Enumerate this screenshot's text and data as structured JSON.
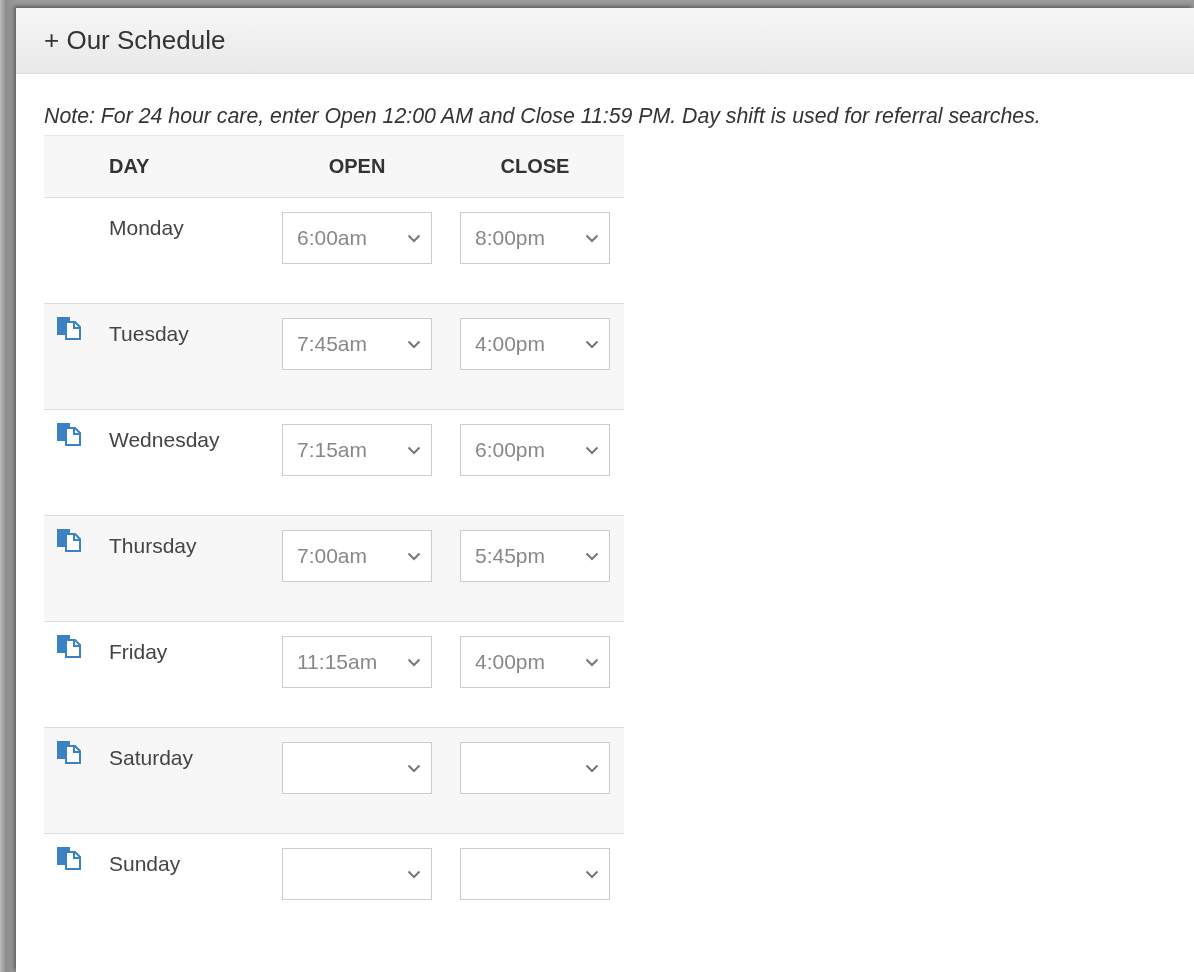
{
  "section": {
    "title": "+ Our Schedule",
    "note": "Note: For 24 hour care, enter Open 12:00 AM and Close 11:59 PM. Day shift is used for referral searches."
  },
  "table": {
    "columns": [
      "DAY",
      "OPEN",
      "CLOSE"
    ],
    "rows": [
      {
        "day": "Monday",
        "copy": false,
        "open": "6:00am",
        "close": "8:00pm"
      },
      {
        "day": "Tuesday",
        "copy": true,
        "open": "7:45am",
        "close": "4:00pm"
      },
      {
        "day": "Wednesday",
        "copy": true,
        "open": "7:15am",
        "close": "6:00pm"
      },
      {
        "day": "Thursday",
        "copy": true,
        "open": "7:00am",
        "close": "5:45pm"
      },
      {
        "day": "Friday",
        "copy": true,
        "open": "11:15am",
        "close": "4:00pm"
      },
      {
        "day": "Saturday",
        "copy": true
      },
      {
        "day": "Sunday",
        "copy": true
      }
    ]
  }
}
